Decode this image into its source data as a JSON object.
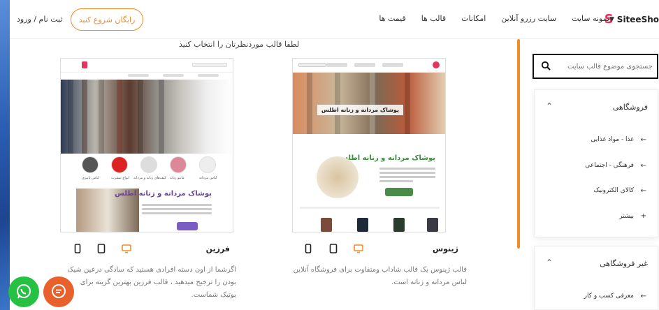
{
  "header": {
    "logo_text": "SiteeSho",
    "logo_mark": "S",
    "nav": [
      {
        "label": "نمونه سایت",
        "has_chevron": true
      },
      {
        "label": "سایت رزرو آنلاین"
      },
      {
        "label": "امکانات"
      },
      {
        "label": "قالب ها"
      },
      {
        "label": "قیمت ها"
      }
    ],
    "cta_label": "رایگان شروع کنید",
    "login_label": "ثبت نام / ورود"
  },
  "page_title": "لطفا قالب موردنظرتان را انتخاب کنید",
  "sidebar": {
    "search_placeholder": "جستجوی موضوع قالب سایت",
    "categories": [
      {
        "title": "فروشگاهی",
        "items": [
          "غذا - مواد غذایی",
          "فرهنگی - اجتماعی",
          "کالای الکترونیک",
          "بیشتر"
        ]
      },
      {
        "title": "غیر فروشگاهی",
        "items": [
          "معرفی کسب و کار"
        ]
      }
    ]
  },
  "templates": [
    {
      "name": "ژینوس",
      "hero_label": "پوشاک مردانه و زنانه اطلس",
      "heading": "پوشاک مردانه و زنانه اطلس",
      "description": "قالب ژینوس یک قالب شاداب ومتفاوت برای فروشگاه آنلاین لباس مردانه و زنانه است."
    },
    {
      "name": "فرزین",
      "heading": "پوشاک مردانه و زنانه اطلس",
      "categories": [
        "لباس پاییزی",
        "انواع تیشرت",
        "کیف‌های زنانه و مردانه",
        "مانتو زنانه",
        "لباس مردانه"
      ],
      "description": "اگرشما از اون دسته افرادی هستید که سادگی درعین شیک بودن را ترجیح میدهید ، قالب فرزین بهترین گزینه برای بوتیک شماست."
    }
  ],
  "colors": {
    "accent": "#f28c28",
    "logo": "#e2365c",
    "whatsapp": "#26c043",
    "chat": "#e8602c"
  },
  "icons": [
    "search-icon",
    "desktop-icon",
    "tablet-icon",
    "mobile-icon",
    "whatsapp-icon",
    "chat-icon",
    "chevron-down-icon",
    "chevron-up-icon",
    "arrow-left-icon"
  ]
}
